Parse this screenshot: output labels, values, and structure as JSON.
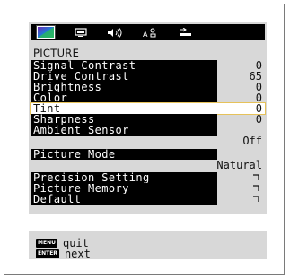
{
  "menu": {
    "tabs": [
      {
        "icon": "picture-icon",
        "active": true
      },
      {
        "icon": "display-icon",
        "active": false
      },
      {
        "icon": "sound-icon",
        "active": false
      },
      {
        "icon": "setup-icon",
        "active": false
      },
      {
        "icon": "input-icon",
        "active": false
      }
    ],
    "section_title": "PICTURE",
    "items": [
      {
        "label": "Signal Contrast",
        "value": "0"
      },
      {
        "label": "Drive Contrast",
        "value": "65"
      },
      {
        "label": "Brightness",
        "value": "0"
      },
      {
        "label": "Color",
        "value": "0"
      },
      {
        "label": "Tint",
        "value": "0",
        "selected": true
      },
      {
        "label": "Sharpness",
        "value": "0"
      },
      {
        "label": "Ambient Sensor",
        "value": "Off"
      },
      {
        "label": "Picture Mode",
        "value": "Natural"
      },
      {
        "label": "Precision Setting",
        "value": ""
      },
      {
        "label": "Picture Memory",
        "value": ""
      },
      {
        "label": "Default",
        "value": ""
      }
    ]
  },
  "help": {
    "quit": {
      "key": "MENU",
      "text": "quit"
    },
    "next": {
      "key": "ENTER",
      "text": "next"
    }
  },
  "colors": {
    "panel_bg": "#d8d8d8",
    "label_bg": "#000000",
    "selected_outline": "#e6c25a"
  }
}
